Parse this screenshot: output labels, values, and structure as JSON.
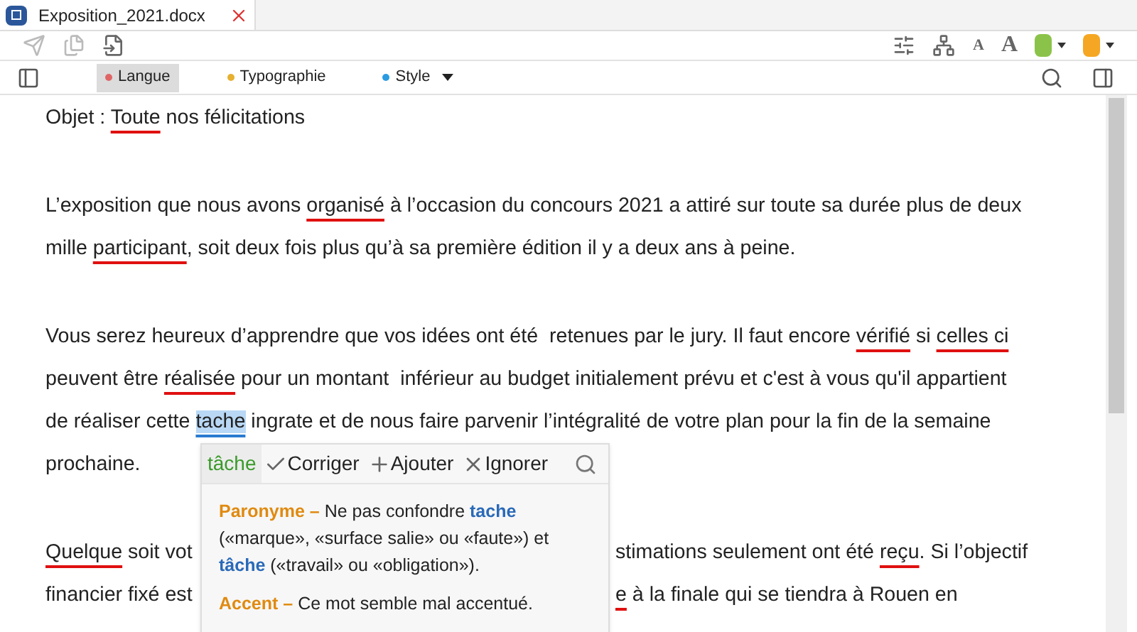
{
  "tab": {
    "title": "Exposition_2021.docx"
  },
  "filters": [
    {
      "label": "Langue",
      "color": "#e06666",
      "selected": true
    },
    {
      "label": "Typographie",
      "color": "#e6b030",
      "selected": false
    },
    {
      "label": "Style",
      "color": "#2a9be0",
      "selected": false
    }
  ],
  "font_buttons": [
    {
      "label": "A",
      "kind": "small"
    },
    {
      "label": "A",
      "kind": "large"
    }
  ],
  "swatches": [
    {
      "color": "#8bc34a"
    },
    {
      "color": "#f5a623"
    }
  ],
  "paragraphs": [
    {
      "lines": [
        {
          "segments": [
            {
              "text": "Objet : ",
              "kind": "plain"
            },
            {
              "text": "Toute",
              "kind": "error"
            },
            {
              "text": " nos félicitations",
              "kind": "plain"
            }
          ]
        }
      ]
    },
    {
      "lines": [
        {
          "segments": [
            {
              "text": "L’exposition que nous avons ",
              "kind": "plain"
            },
            {
              "text": "organisé",
              "kind": "error"
            },
            {
              "text": " à l’occasion du concours 2021 a attiré sur toute sa durée plus de deux",
              "kind": "plain"
            }
          ]
        },
        {
          "segments": [
            {
              "text": "mille ",
              "kind": "plain"
            },
            {
              "text": "participant",
              "kind": "error"
            },
            {
              "text": ", soit deux fois plus qu’à sa première édition il y a deux ans à peine.",
              "kind": "plain"
            }
          ]
        }
      ]
    },
    {
      "lines": [
        {
          "segments": [
            {
              "text": "Vous serez heureux d’apprendre que vos idées ont été  retenues par le jury. Il faut encore ",
              "kind": "plain"
            },
            {
              "text": "vérifié",
              "kind": "error"
            },
            {
              "text": " si ",
              "kind": "plain"
            },
            {
              "text": "celles ci",
              "kind": "error"
            }
          ]
        },
        {
          "segments": [
            {
              "text": "peuvent être ",
              "kind": "plain"
            },
            {
              "text": "réalisée",
              "kind": "error"
            },
            {
              "text": " pour un montant  inférieur au budget initialement prévu et c'est à vous qu'il appartient",
              "kind": "plain"
            }
          ]
        },
        {
          "segments": [
            {
              "text": "de réaliser cette ",
              "kind": "plain"
            },
            {
              "text": "tache",
              "kind": "highlight"
            },
            {
              "text": " ingrate et de nous faire parvenir l’intégralité de votre plan pour la fin de la semaine",
              "kind": "plain"
            }
          ]
        },
        {
          "segments": [
            {
              "text": "prochaine.",
              "kind": "plain"
            }
          ]
        }
      ]
    },
    {
      "lines": [
        {
          "segments": [
            {
              "text": "Quelque",
              "kind": "error"
            },
            {
              "text": " soit vot",
              "kind": "plain"
            }
          ],
          "right": [
            {
              "text": "stimations seulement ont été ",
              "kind": "plain"
            },
            {
              "text": "reçu",
              "kind": "error"
            },
            {
              "text": ". Si l’objectif",
              "kind": "plain"
            }
          ]
        },
        {
          "segments": [
            {
              "text": "financier fixé est",
              "kind": "plain"
            }
          ],
          "right": [
            {
              "text": "e",
              "kind": "error"
            },
            {
              "text": " à la finale qui se tiendra à Rouen en",
              "kind": "plain"
            }
          ]
        }
      ]
    }
  ],
  "popup": {
    "word": "tâche",
    "actions": [
      {
        "label": "Corriger",
        "kind": "check"
      },
      {
        "label": "Ajouter",
        "kind": "plus"
      },
      {
        "label": "Ignorer",
        "kind": "cross"
      }
    ],
    "entries": [
      {
        "title": "Paronyme –",
        "segments": [
          {
            "text": "Ne pas confondre ",
            "kind": "plain"
          },
          {
            "text": "tache",
            "kind": "term"
          },
          {
            "text": " («marque», «surface salie» ou «faute») et ",
            "kind": "plain"
          },
          {
            "text": "tâche",
            "kind": "term"
          },
          {
            "text": " («travail» ou «obligation»).",
            "kind": "plain"
          }
        ]
      },
      {
        "title": "Accent –",
        "segments": [
          {
            "text": "Ce mot semble mal accentué.",
            "kind": "plain"
          }
        ]
      }
    ]
  }
}
